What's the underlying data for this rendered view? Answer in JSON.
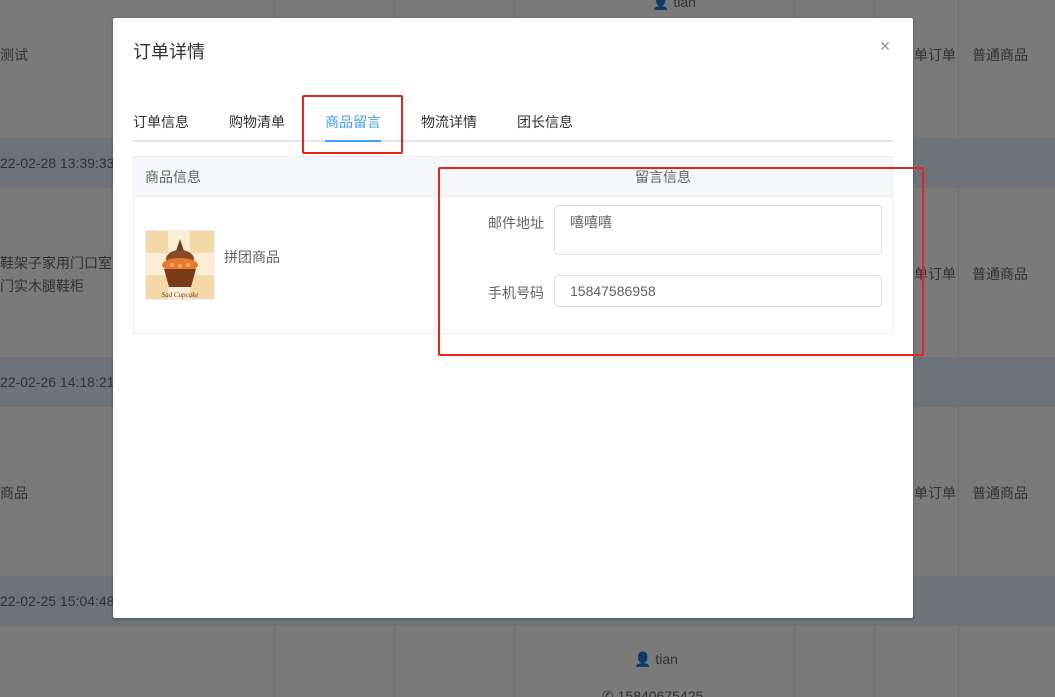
{
  "background": {
    "rows": [
      {
        "name": "测试",
        "order_type": "单订单",
        "goods_type": "普通商品"
      },
      {
        "date": "22-02-28 13:39:33"
      },
      {
        "name_line1": "鞋架子家用门口室内",
        "name_line2": "门实木腿鞋柜",
        "order_type": "单订单",
        "goods_type": "普通商品"
      },
      {
        "date": "22-02-26 14:18:21"
      },
      {
        "name": "商品",
        "order_type": "单订单",
        "goods_type": "普通商品"
      },
      {
        "date": "22-02-25 15:04:48"
      }
    ],
    "user_top": "tian",
    "user_bottom": "tian",
    "phone_bottom": "15840675425"
  },
  "dialog": {
    "title": "订单详情",
    "close_label": "×",
    "tabs": [
      {
        "label": "订单信息"
      },
      {
        "label": "购物清单"
      },
      {
        "label": "商品留言"
      },
      {
        "label": "物流详情"
      },
      {
        "label": "团长信息"
      }
    ],
    "active_tab": "商品留言",
    "grid": {
      "col_product": "商品信息",
      "col_message": "留言信息",
      "product_name": "拼团商品",
      "product_image_text": "Sad Cupcake",
      "fields": [
        {
          "label": "邮件地址",
          "value": "嘻嘻嘻"
        },
        {
          "label": "手机号码",
          "value": "15847586958"
        }
      ]
    }
  },
  "colors": {
    "accent": "#409eff",
    "highlight": "#e4251b"
  }
}
